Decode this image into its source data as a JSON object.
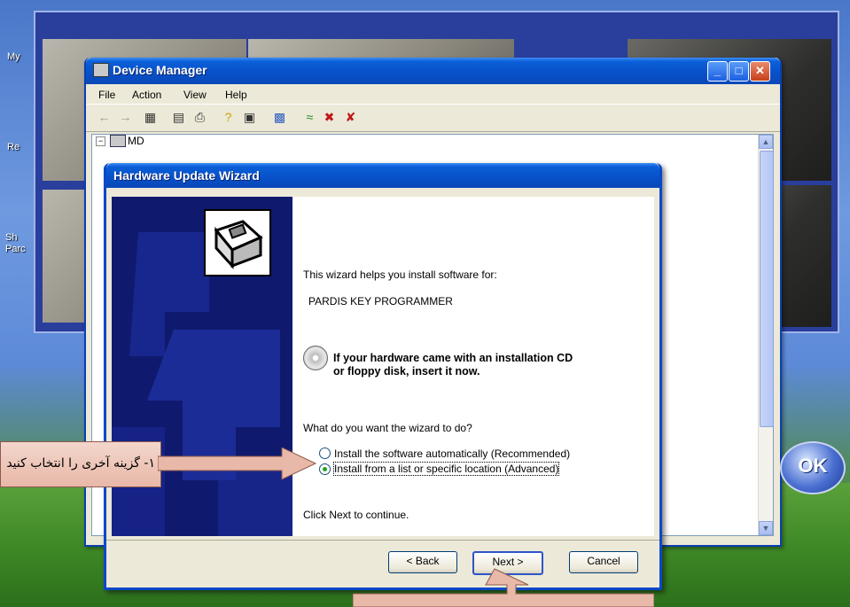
{
  "desktop": {
    "icons": [
      "My",
      "Re",
      "Sh Parc"
    ],
    "ok_label": "OK"
  },
  "device_manager": {
    "title": "Device Manager",
    "menu": [
      "File",
      "Action",
      "View",
      "Help"
    ],
    "tree_root": "MD"
  },
  "wizard": {
    "title": "Hardware Update Wizard",
    "intro": "This wizard helps you install software for:",
    "device_name": "PARDIS KEY PROGRAMMER",
    "cd_note_line1": "If your hardware came with an installation CD",
    "cd_note_line2": "or floppy disk, insert it now.",
    "question": "What do you want the wizard to do?",
    "options": [
      {
        "label": "Install the software automatically (Recommended)",
        "selected": false
      },
      {
        "label": "Install from a list or specific location (Advanced)",
        "selected": true
      }
    ],
    "footer_text": "Click Next to continue.",
    "buttons": {
      "back": "< Back",
      "next": "Next >",
      "cancel": "Cancel"
    }
  },
  "annotations": {
    "callout_option": "۱- گزینه آخری را انتخاب کنید"
  },
  "colors": {
    "titlebar": "#0a5fd8",
    "wizard_panel": "#0f1a6e",
    "callout": "#e8b8a8"
  }
}
